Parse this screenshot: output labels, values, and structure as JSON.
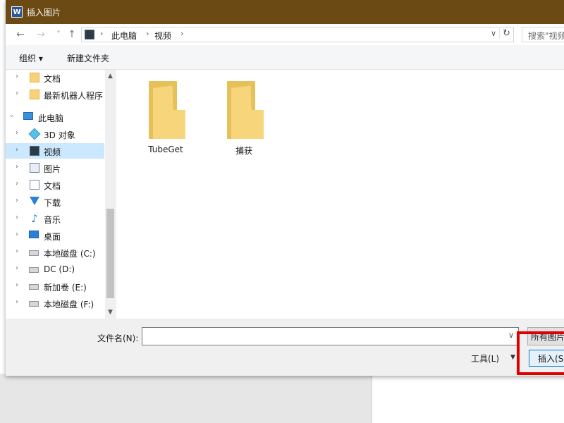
{
  "dialog": {
    "title": "插入图片",
    "app_icon": "W"
  },
  "nav": {
    "back": "←",
    "forward": "→",
    "recent": "˅",
    "up": "↑",
    "breadcrumbs": [
      "此电脑",
      "视频"
    ],
    "search_placeholder": "搜索\"视频\""
  },
  "toolbar": {
    "organize": "组织 ▾",
    "new_folder": "新建文件夹"
  },
  "sidebar": {
    "items": [
      {
        "label": "文档",
        "icon": "folder-icon"
      },
      {
        "label": "最新机器人程序",
        "icon": "folder-icon"
      },
      {
        "label": "此电脑",
        "icon": "computer-icon"
      },
      {
        "label": "3D 对象",
        "icon": "3d-objects-icon"
      },
      {
        "label": "视频",
        "icon": "videos-icon"
      },
      {
        "label": "图片",
        "icon": "pictures-icon"
      },
      {
        "label": "文档",
        "icon": "documents-icon"
      },
      {
        "label": "下载",
        "icon": "downloads-icon"
      },
      {
        "label": "音乐",
        "icon": "music-icon"
      },
      {
        "label": "桌面",
        "icon": "desktop-icon"
      },
      {
        "label": "本地磁盘 (C:)",
        "icon": "system-drive-icon"
      },
      {
        "label": "DC (D:)",
        "icon": "drive-icon"
      },
      {
        "label": "新加卷 (E:)",
        "icon": "drive-icon"
      },
      {
        "label": "本地磁盘 (F:)",
        "icon": "drive-icon"
      }
    ],
    "selected_label": "视频"
  },
  "files": [
    {
      "name": "TubeGet",
      "icon": "folder-icon"
    },
    {
      "name": "捕获",
      "icon": "folder-icon"
    }
  ],
  "bottom": {
    "filename_label": "文件名(N):",
    "filename_value": "",
    "filter_value": "所有图片",
    "tools_label": "工具(L)",
    "insert_label": "插入(S)"
  }
}
